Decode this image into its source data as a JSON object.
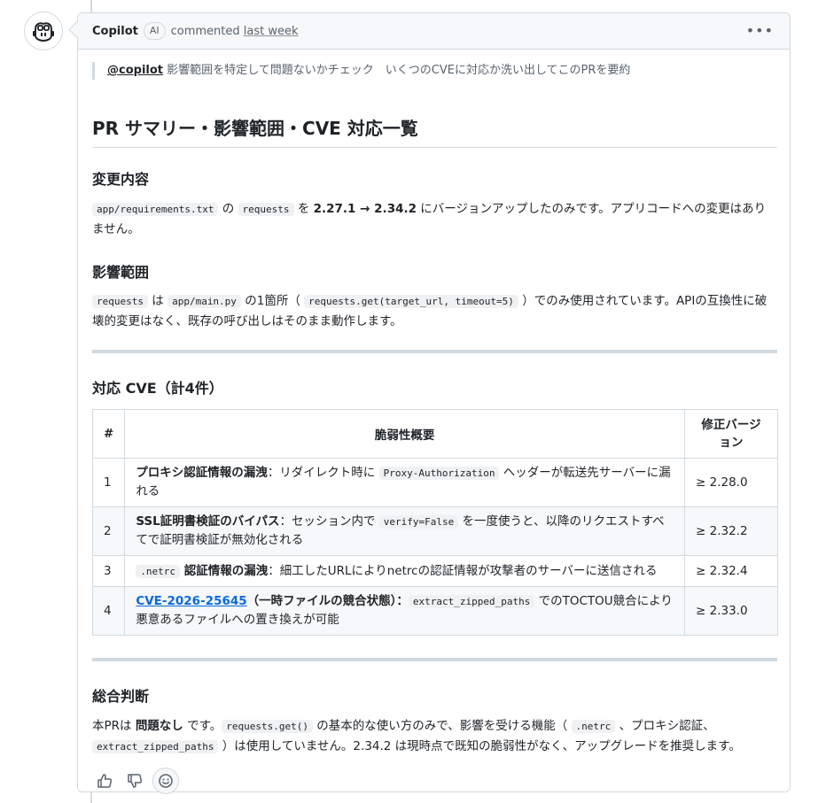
{
  "comment": {
    "author": "Copilot",
    "badge": "AI",
    "action": "commented",
    "when": "last week",
    "more_icon": "kebab-horizontal-icon"
  },
  "quote": {
    "mention": "@copilot",
    "text": " 影響範囲を特定して問題ないかチェック　いくつのCVEに対応か洗い出してこのPRを要約"
  },
  "title": "PR サマリー・影響範囲・CVE 対応一覧",
  "changes": {
    "heading": "変更内容",
    "file_code": "app/requirements.txt",
    "t1": " の ",
    "pkg_code": "requests",
    "t2": " を ",
    "versions": "2.27.1 → 2.34.2",
    "t3": " にバージョンアップしたのみです。アプリコードへの変更はありません。"
  },
  "impact": {
    "heading": "影響範囲",
    "pkg_code": "requests",
    "t1": " は ",
    "file_code": "app/main.py",
    "t2": " の1箇所（ ",
    "call_code": "requests.get(target_url, timeout=5)",
    "t3": " ）でのみ使用されています。APIの互換性に破壊的変更はなく、既存の呼び出しはそのまま動作します。"
  },
  "cve": {
    "heading": "対応 CVE（計4件）",
    "columns": [
      "#",
      "脆弱性概要",
      "修正バージョン"
    ],
    "rows": [
      {
        "num": "1",
        "title": "プロキシ認証情報の漏洩",
        "sep": "：リダイレクト時に ",
        "code": "Proxy-Authorization",
        "desc": " ヘッダーが転送先サーバーに漏れる",
        "fix": "≥ 2.28.0"
      },
      {
        "num": "2",
        "title": "SSL証明書検証のバイパス",
        "sep": "：セッション内で ",
        "code": "verify=False",
        "desc": " を一度使うと、以降のリクエストすべてで証明書検証が無効化される",
        "fix": "≥ 2.32.2"
      },
      {
        "num": "3",
        "code": ".netrc",
        "title": " 認証情報の漏洩",
        "desc": "：細工したURLによりnetrcの認証情報が攻撃者のサーバーに送信される",
        "fix": "≥ 2.32.4"
      },
      {
        "num": "4",
        "link": "CVE-2026-25645",
        "title": "（一時ファイルの競合状態）",
        "sep": "：",
        "code": "extract_zipped_paths",
        "desc": " でのTOCTOU競合により悪意あるファイルへの置き換えが可能",
        "fix": "≥ 2.33.0"
      }
    ]
  },
  "verdict": {
    "heading": "総合判断",
    "t1": "本PRは ",
    "strong": "問題なし",
    "t2": " です。",
    "code1": "requests.get()",
    "t3": " の基本的な使い方のみで、影響を受ける機能（ ",
    "code2": ".netrc",
    "t4": " 、プロキシ認証、",
    "code3": "extract_zipped_paths",
    "t5": " ）は使用していません。2.34.2 は現時点で既知の脆弱性がなく、アップグレードを推奨します。"
  },
  "reactions": {
    "icons": [
      "thumbs-up-icon",
      "thumbs-down-icon",
      "smiley-icon"
    ]
  }
}
